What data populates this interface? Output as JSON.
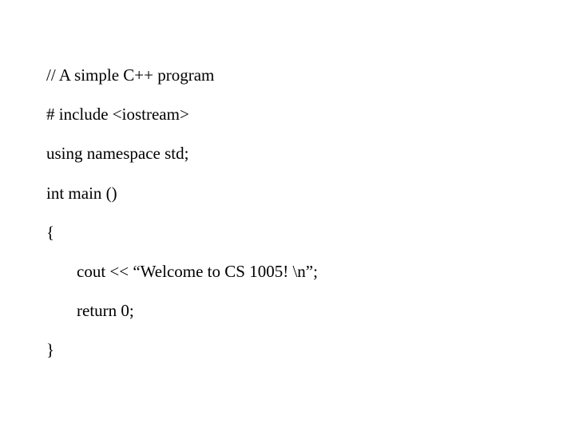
{
  "code": {
    "line1": "// A simple C++ program",
    "line2": "# include <iostream>",
    "line3": "using namespace std;",
    "line4": "int main ()",
    "line5": "{",
    "line6": "cout << “Welcome to CS 1005! \\n”;",
    "line7": "return 0;",
    "line8": "}"
  }
}
